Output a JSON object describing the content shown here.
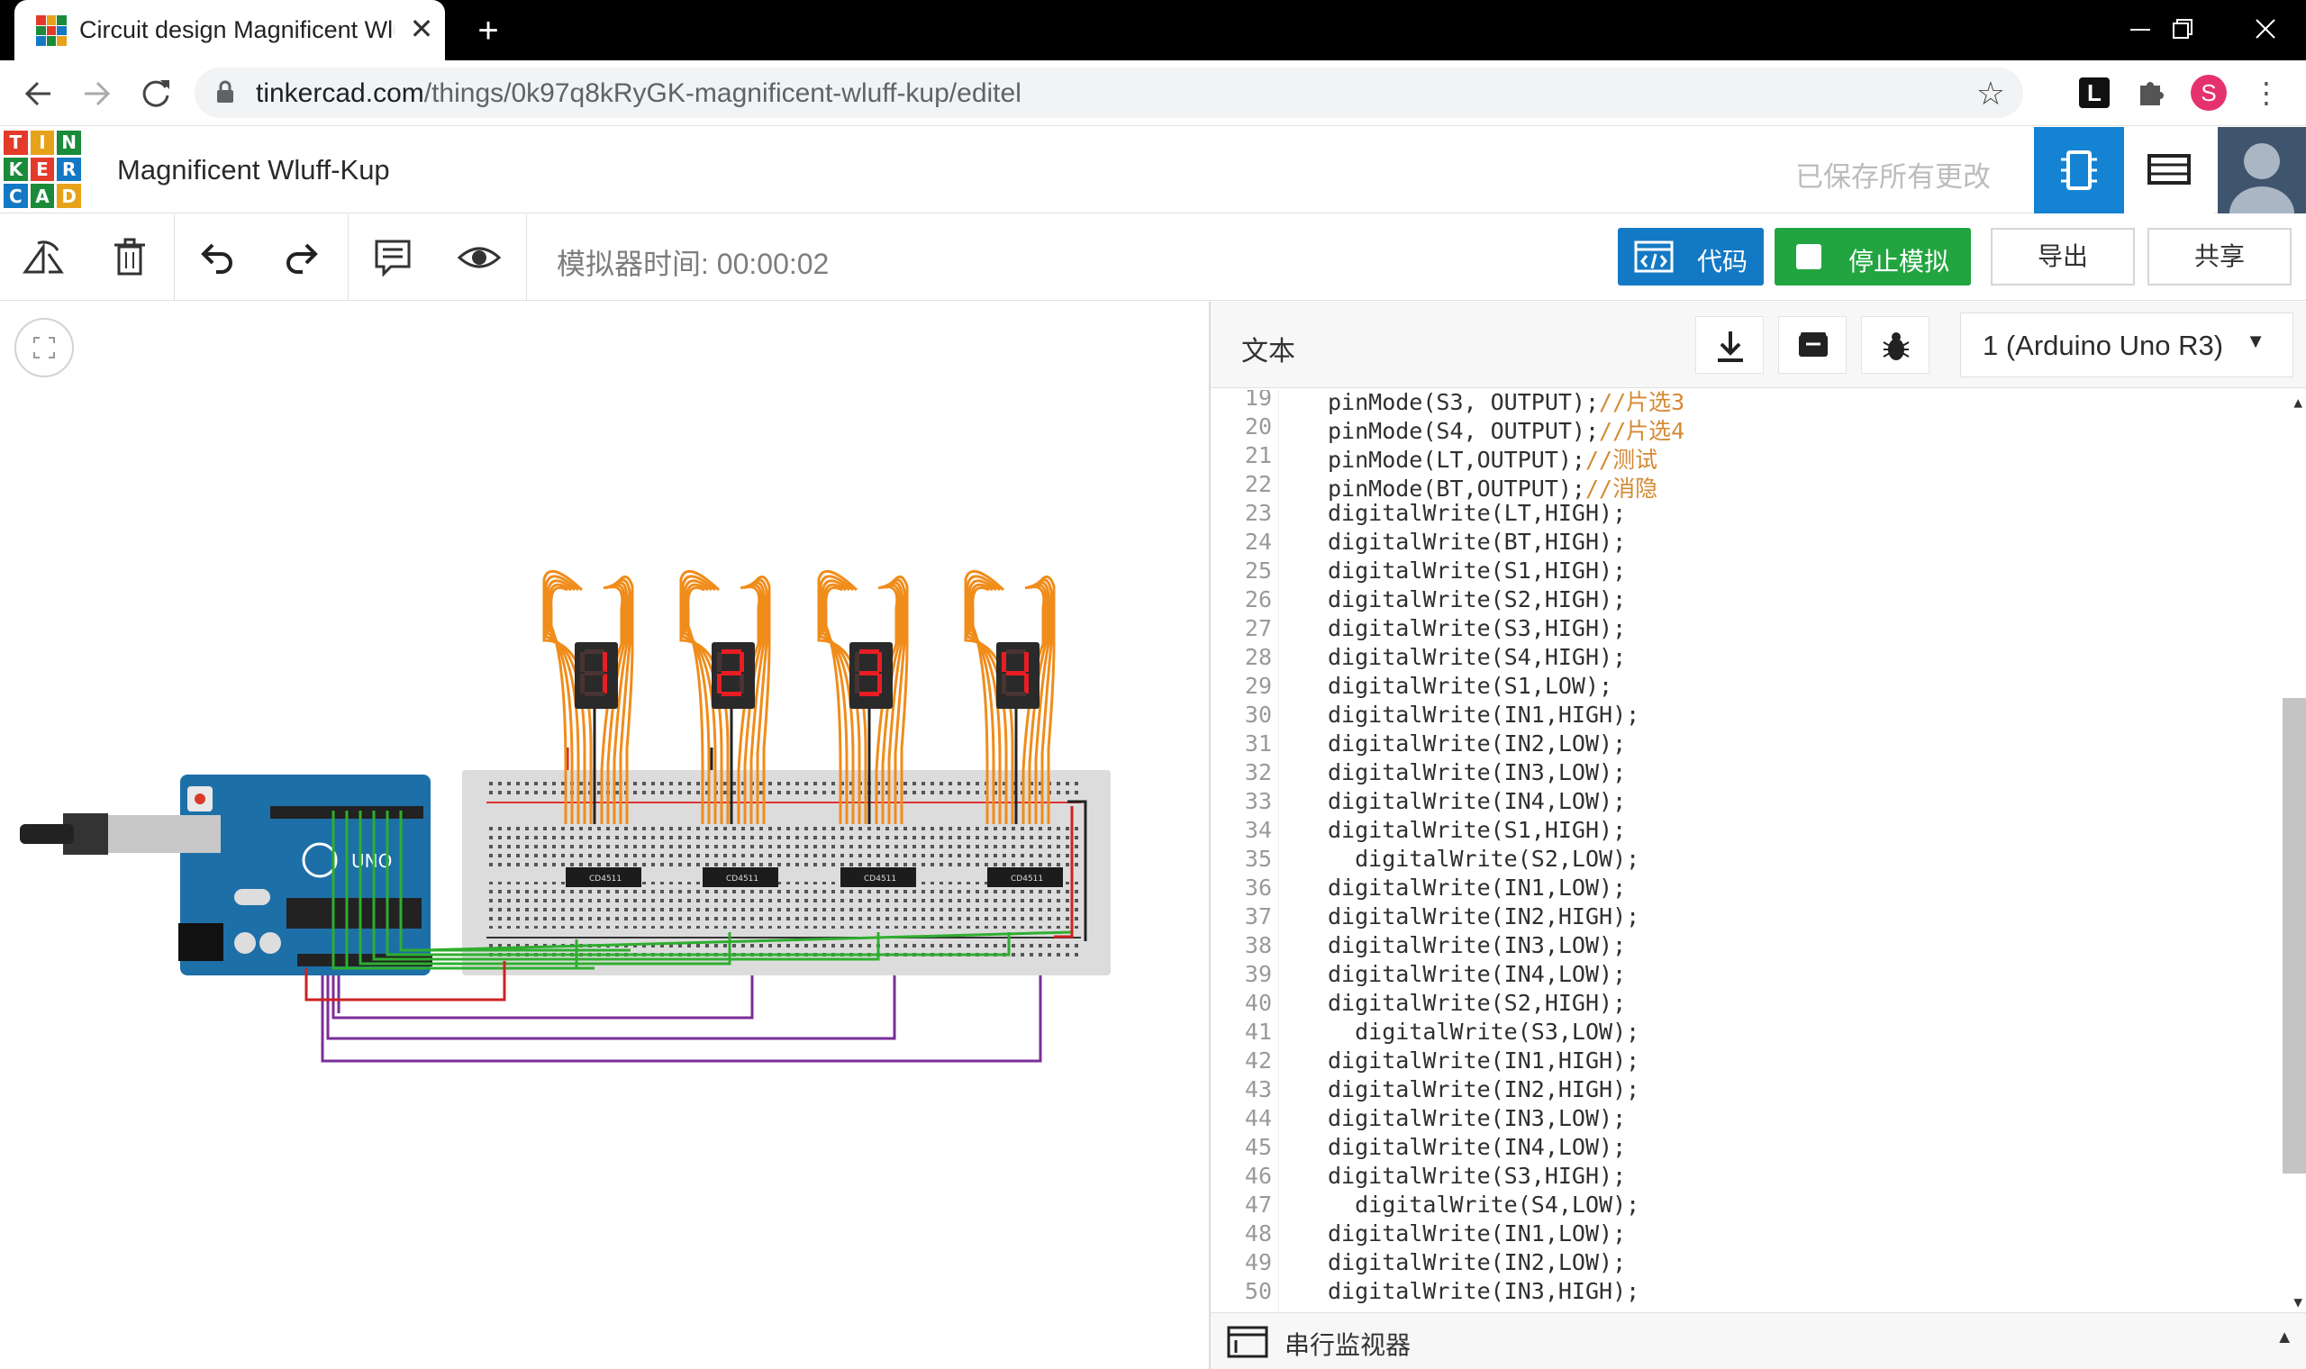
{
  "browser": {
    "tab_title": "Circuit design Magnificent Wlu",
    "close_label": "✕",
    "new_tab_label": "+",
    "url_domain": "tinkercad.com",
    "url_path": "/things/0k97q8kRyGK-magnificent-wluff-kup/editel",
    "profile_initial": "S",
    "ext_label": "L"
  },
  "app": {
    "logo_letters": [
      "T",
      "I",
      "N",
      "K",
      "E",
      "R",
      "C",
      "A",
      "D"
    ],
    "logo_colors": [
      "#e33a2a",
      "#e8a21a",
      "#1b8a3a",
      "#1b8a3a",
      "#e33a2a",
      "#1479c4",
      "#1479c4",
      "#1b8a3a",
      "#e8a21a"
    ],
    "project_title": "Magnificent Wluff-Kup",
    "save_status": "已保存所有更改"
  },
  "toolbar": {
    "sim_time": "模拟器时间: 00:00:02",
    "code_label": "代码",
    "stop_label": "停止模拟",
    "export_label": "导出",
    "share_label": "共享"
  },
  "circuit": {
    "displays": [
      "1",
      "2",
      "3",
      "4"
    ],
    "chip_label": "CD4511",
    "arduino_label": "UNO"
  },
  "code_panel": {
    "mode_label": "文本",
    "device": "1 (Arduino Uno R3)",
    "serial_label": "串行监视器"
  },
  "code": {
    "lines": [
      {
        "n": "19",
        "text": "pinMode(S3, OUTPUT);",
        "comment": "//片选3"
      },
      {
        "n": "20",
        "text": "pinMode(S4, OUTPUT);",
        "comment": "//片选4"
      },
      {
        "n": "21",
        "text": "pinMode(LT,OUTPUT);",
        "comment": "//测试"
      },
      {
        "n": "22",
        "text": "pinMode(BT,OUTPUT);",
        "comment": "//消隐"
      },
      {
        "n": "23",
        "text": "digitalWrite(LT,HIGH);",
        "comment": ""
      },
      {
        "n": "24",
        "text": "digitalWrite(BT,HIGH);",
        "comment": ""
      },
      {
        "n": "25",
        "text": "digitalWrite(S1,HIGH);",
        "comment": ""
      },
      {
        "n": "26",
        "text": "digitalWrite(S2,HIGH);",
        "comment": ""
      },
      {
        "n": "27",
        "text": "digitalWrite(S3,HIGH);",
        "comment": ""
      },
      {
        "n": "28",
        "text": "digitalWrite(S4,HIGH);",
        "comment": ""
      },
      {
        "n": "29",
        "text": "digitalWrite(S1,LOW);",
        "comment": ""
      },
      {
        "n": "30",
        "text": "digitalWrite(IN1,HIGH);",
        "comment": ""
      },
      {
        "n": "31",
        "text": "digitalWrite(IN2,LOW);",
        "comment": ""
      },
      {
        "n": "32",
        "text": "digitalWrite(IN3,LOW);",
        "comment": ""
      },
      {
        "n": "33",
        "text": "digitalWrite(IN4,LOW);",
        "comment": ""
      },
      {
        "n": "34",
        "text": "digitalWrite(S1,HIGH);",
        "comment": ""
      },
      {
        "n": "35",
        "text": "  digitalWrite(S2,LOW);",
        "comment": ""
      },
      {
        "n": "36",
        "text": "digitalWrite(IN1,LOW);",
        "comment": ""
      },
      {
        "n": "37",
        "text": "digitalWrite(IN2,HIGH);",
        "comment": ""
      },
      {
        "n": "38",
        "text": "digitalWrite(IN3,LOW);",
        "comment": ""
      },
      {
        "n": "39",
        "text": "digitalWrite(IN4,LOW);",
        "comment": ""
      },
      {
        "n": "40",
        "text": "digitalWrite(S2,HIGH);",
        "comment": ""
      },
      {
        "n": "41",
        "text": "  digitalWrite(S3,LOW);",
        "comment": ""
      },
      {
        "n": "42",
        "text": "digitalWrite(IN1,HIGH);",
        "comment": ""
      },
      {
        "n": "43",
        "text": "digitalWrite(IN2,HIGH);",
        "comment": ""
      },
      {
        "n": "44",
        "text": "digitalWrite(IN3,LOW);",
        "comment": ""
      },
      {
        "n": "45",
        "text": "digitalWrite(IN4,LOW);",
        "comment": ""
      },
      {
        "n": "46",
        "text": "digitalWrite(S3,HIGH);",
        "comment": ""
      },
      {
        "n": "47",
        "text": "  digitalWrite(S4,LOW);",
        "comment": ""
      },
      {
        "n": "48",
        "text": "digitalWrite(IN1,LOW);",
        "comment": ""
      },
      {
        "n": "49",
        "text": "digitalWrite(IN2,LOW);",
        "comment": ""
      },
      {
        "n": "50",
        "text": "digitalWrite(IN3,HIGH);",
        "comment": ""
      }
    ]
  }
}
